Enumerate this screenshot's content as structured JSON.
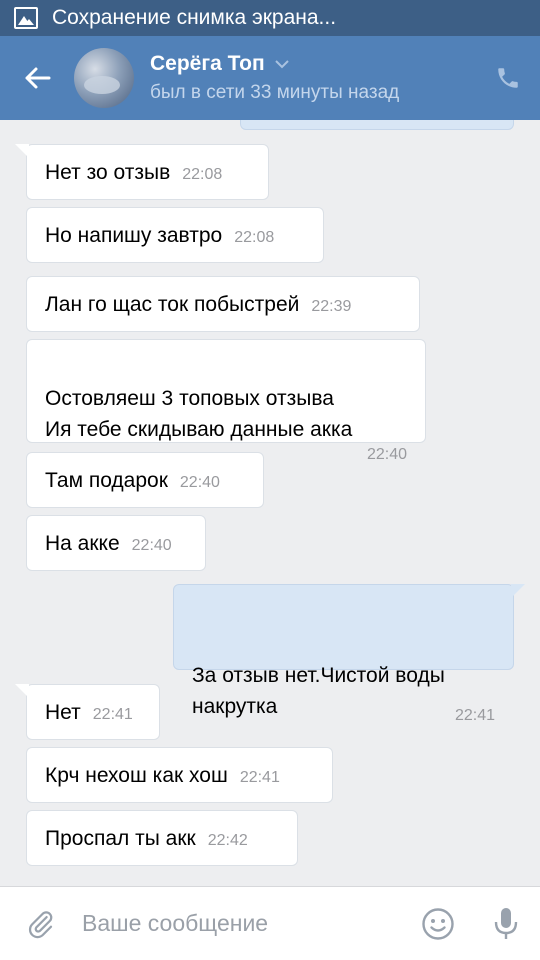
{
  "statusbar": {
    "text": "Сохранение снимка экрана..."
  },
  "header": {
    "name": "Серёга Топ",
    "last_seen": "был в сети 33 минуты назад",
    "back_icon": "arrow-left-icon",
    "call_icon": "phone-icon"
  },
  "messages": [
    {
      "dir": "in",
      "text": "Нет зо отзыв",
      "time": "22:08"
    },
    {
      "dir": "in",
      "text": "Но напишу завтро",
      "time": "22:08"
    },
    {
      "dir": "in",
      "text": "Лан го щас ток побыстрей",
      "time": "22:39"
    },
    {
      "dir": "in",
      "text": "Остовляеш 3 топовых отзыва\nИя тебе скидываю данные акка",
      "time": "22:40"
    },
    {
      "dir": "in",
      "text": "Там подарок",
      "time": "22:40"
    },
    {
      "dir": "in",
      "text": "На акке",
      "time": "22:40"
    },
    {
      "dir": "out",
      "text": "За отзыв нет.Чистой воды\nнакрутка",
      "time": "22:41"
    },
    {
      "dir": "in",
      "text": "Нет",
      "time": "22:41"
    },
    {
      "dir": "in",
      "text": "Крч нехош как хош",
      "time": "22:41"
    },
    {
      "dir": "in",
      "text": "Проспал ты акк",
      "time": "22:42"
    }
  ],
  "composer": {
    "placeholder": "Ваше сообщение",
    "attach_icon": "paperclip-icon",
    "emoji_icon": "smiley-icon",
    "mic_icon": "microphone-icon"
  },
  "colors": {
    "header": "#5181b8",
    "statusbar": "#3d5f86",
    "chat_bg": "#edeef0",
    "outgoing_bubble": "#d8e6f5"
  }
}
